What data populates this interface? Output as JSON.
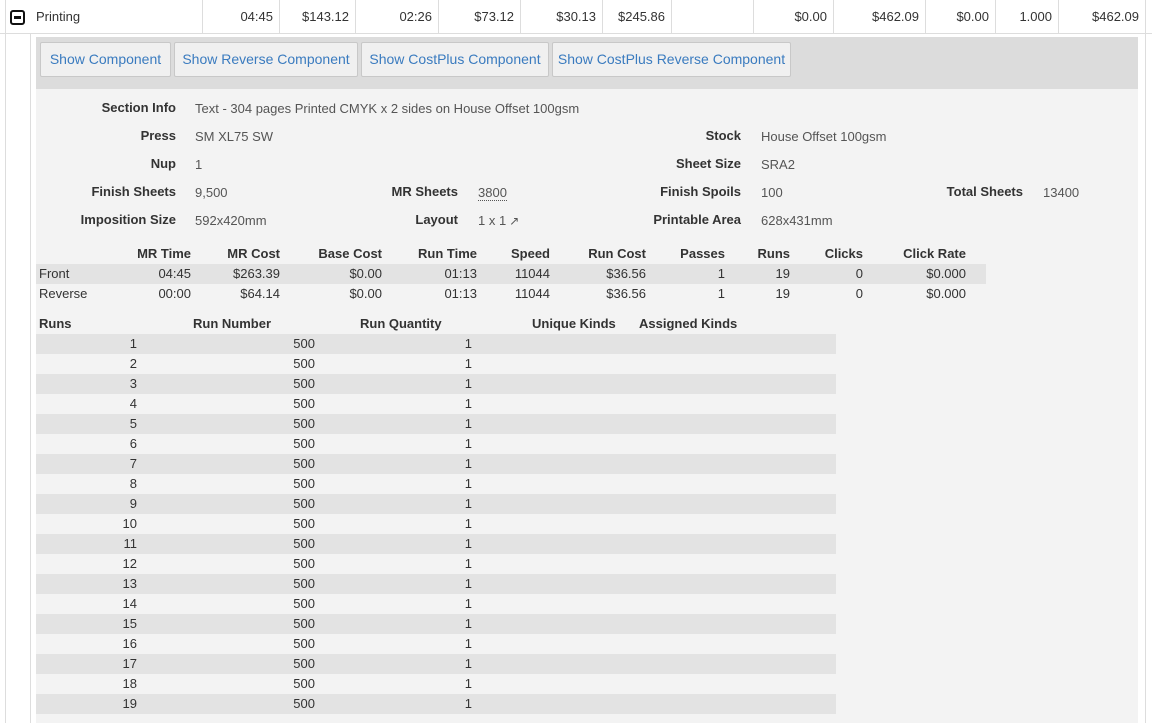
{
  "summary_row": {
    "name": "Printing",
    "cells": [
      "04:45",
      "$143.12",
      "02:26",
      "$73.12",
      "$30.13",
      "$245.86",
      "",
      "$0.00",
      "$462.09",
      "$0.00",
      "1.000",
      "$462.09"
    ]
  },
  "buttons": {
    "show_component": "Show Component",
    "show_reverse_component": "Show Reverse Component",
    "show_costplus_component": "Show CostPlus Component",
    "show_costplus_reverse_component": "Show CostPlus Reverse Component"
  },
  "info": {
    "section_info_label": "Section Info",
    "section_info_value": "Text - 304 pages Printed CMYK x 2 sides on House Offset 100gsm",
    "press_label": "Press",
    "press_value": "SM XL75 SW",
    "stock_label": "Stock",
    "stock_value": "House Offset 100gsm",
    "nup_label": "Nup",
    "nup_value": "1",
    "sheet_size_label": "Sheet Size",
    "sheet_size_value": "SRA2",
    "finish_sheets_label": "Finish Sheets",
    "finish_sheets_value": "9,500",
    "mr_sheets_label": "MR Sheets",
    "mr_sheets_value": "3800",
    "finish_spoils_label": "Finish Spoils",
    "finish_spoils_value": "100",
    "total_sheets_label": "Total Sheets",
    "total_sheets_value": "13400",
    "imposition_size_label": "Imposition Size",
    "imposition_size_value": "592x420mm",
    "layout_label": "Layout",
    "layout_value": "1 x 1",
    "layout_icon": "external-link-icon",
    "printable_area_label": "Printable Area",
    "printable_area_value": "628x431mm"
  },
  "cost_table": {
    "headers": [
      "MR Time",
      "MR Cost",
      "Base Cost",
      "Run Time",
      "Speed",
      "Run Cost",
      "Passes",
      "Runs",
      "Clicks",
      "Click Rate"
    ],
    "rows": [
      {
        "side": "Front",
        "values": [
          "04:45",
          "$263.39",
          "$0.00",
          "01:13",
          "11044",
          "$36.56",
          "1",
          "19",
          "0",
          "$0.000"
        ]
      },
      {
        "side": "Reverse",
        "values": [
          "00:00",
          "$64.14",
          "$0.00",
          "01:13",
          "11044",
          "$36.56",
          "1",
          "19",
          "0",
          "$0.000"
        ]
      }
    ]
  },
  "runs_table": {
    "headers": [
      "Runs",
      "Run Number",
      "Run Quantity",
      "Unique Kinds",
      "Assigned Kinds"
    ],
    "rows": [
      [
        "1",
        "500",
        "1"
      ],
      [
        "2",
        "500",
        "1"
      ],
      [
        "3",
        "500",
        "1"
      ],
      [
        "4",
        "500",
        "1"
      ],
      [
        "5",
        "500",
        "1"
      ],
      [
        "6",
        "500",
        "1"
      ],
      [
        "7",
        "500",
        "1"
      ],
      [
        "8",
        "500",
        "1"
      ],
      [
        "9",
        "500",
        "1"
      ],
      [
        "10",
        "500",
        "1"
      ],
      [
        "11",
        "500",
        "1"
      ],
      [
        "12",
        "500",
        "1"
      ],
      [
        "13",
        "500",
        "1"
      ],
      [
        "14",
        "500",
        "1"
      ],
      [
        "15",
        "500",
        "1"
      ],
      [
        "16",
        "500",
        "1"
      ],
      [
        "17",
        "500",
        "1"
      ],
      [
        "18",
        "500",
        "1"
      ],
      [
        "19",
        "500",
        "1"
      ]
    ]
  },
  "colors": {
    "link_blue": "#3a7bbf",
    "stripe": "#e3e3e3",
    "panel_bg": "#f3f3f3"
  }
}
